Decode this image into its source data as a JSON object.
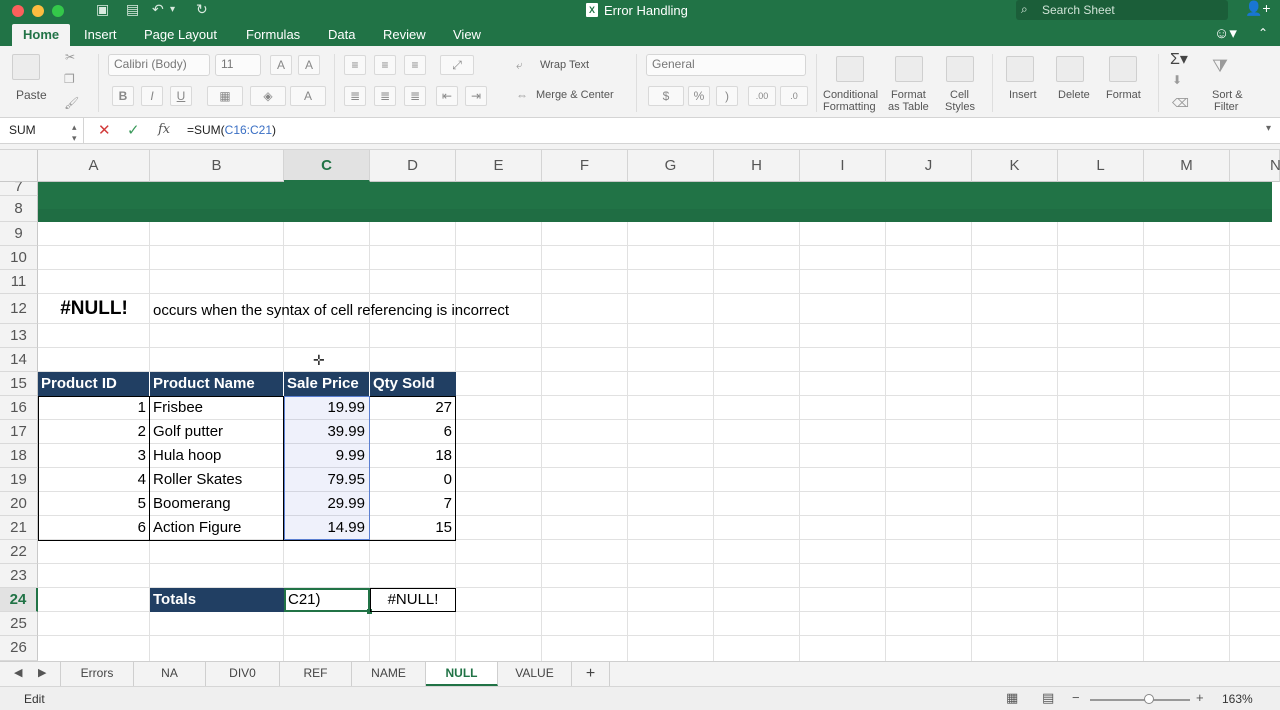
{
  "window": {
    "title": "Error Handling",
    "search_placeholder": "Search Sheet"
  },
  "tabs": [
    "Home",
    "Insert",
    "Page Layout",
    "Formulas",
    "Data",
    "Review",
    "View"
  ],
  "ribbon": {
    "paste": "Paste",
    "font_name": "Calibri (Body)",
    "font_size": "11",
    "bold": "B",
    "italic": "I",
    "underline": "U",
    "wrap_text": "Wrap Text",
    "merge_center": "Merge & Center",
    "number_format": "General",
    "currency": "$",
    "percent": "%",
    "comma": ")",
    "conditional_formatting": [
      "Conditional",
      "Formatting"
    ],
    "format_as_table": [
      "Format",
      "as Table"
    ],
    "cell_styles": [
      "Cell",
      "Styles"
    ],
    "insert": "Insert",
    "delete": "Delete",
    "format": "Format",
    "sort_filter": [
      "Sort &",
      "Filter"
    ]
  },
  "formula_bar": {
    "name_box": "SUM",
    "formula_prefix": "=SUM(",
    "formula_ref": "C16:C21",
    "formula_suffix": ")",
    "fx": "fx"
  },
  "columns": [
    "A",
    "B",
    "C",
    "D",
    "E",
    "F",
    "G",
    "H",
    "I",
    "J",
    "K",
    "L",
    "M",
    "N"
  ],
  "rows": [
    "7",
    "8",
    "9",
    "10",
    "11",
    "12",
    "13",
    "14",
    "15",
    "16",
    "17",
    "18",
    "19",
    "20",
    "21",
    "22",
    "23",
    "24",
    "25",
    "26"
  ],
  "content": {
    "null_label": "#NULL!",
    "description": "occurs when the syntax of cell referencing is incorrect",
    "table_headers": [
      "Product ID",
      "Product Name",
      "Sale Price",
      "Qty Sold"
    ],
    "table_rows": [
      [
        "1",
        "Frisbee",
        "19.99",
        "27"
      ],
      [
        "2",
        "Golf putter",
        "39.99",
        "6"
      ],
      [
        "3",
        "Hula hoop",
        "9.99",
        "18"
      ],
      [
        "4",
        "Roller Skates",
        "79.95",
        "0"
      ],
      [
        "5",
        "Boomerang",
        "29.99",
        "7"
      ],
      [
        "6",
        "Action Figure",
        "14.99",
        "15"
      ]
    ],
    "totals_label": "Totals",
    "totals_edit": "C21)",
    "totals_qty": "#NULL!"
  },
  "sheet_tabs": [
    "Errors",
    "NA",
    "DIV0",
    "REF",
    "NAME",
    "NULL",
    "VALUE"
  ],
  "active_sheet": "NULL",
  "add_sheet": "+",
  "status": {
    "mode": "Edit",
    "zoom": "163%",
    "zoom_level_percent": 163
  },
  "colors": {
    "excel_green": "#217346",
    "table_header": "#213f63",
    "selection": "#5b7fd1"
  }
}
